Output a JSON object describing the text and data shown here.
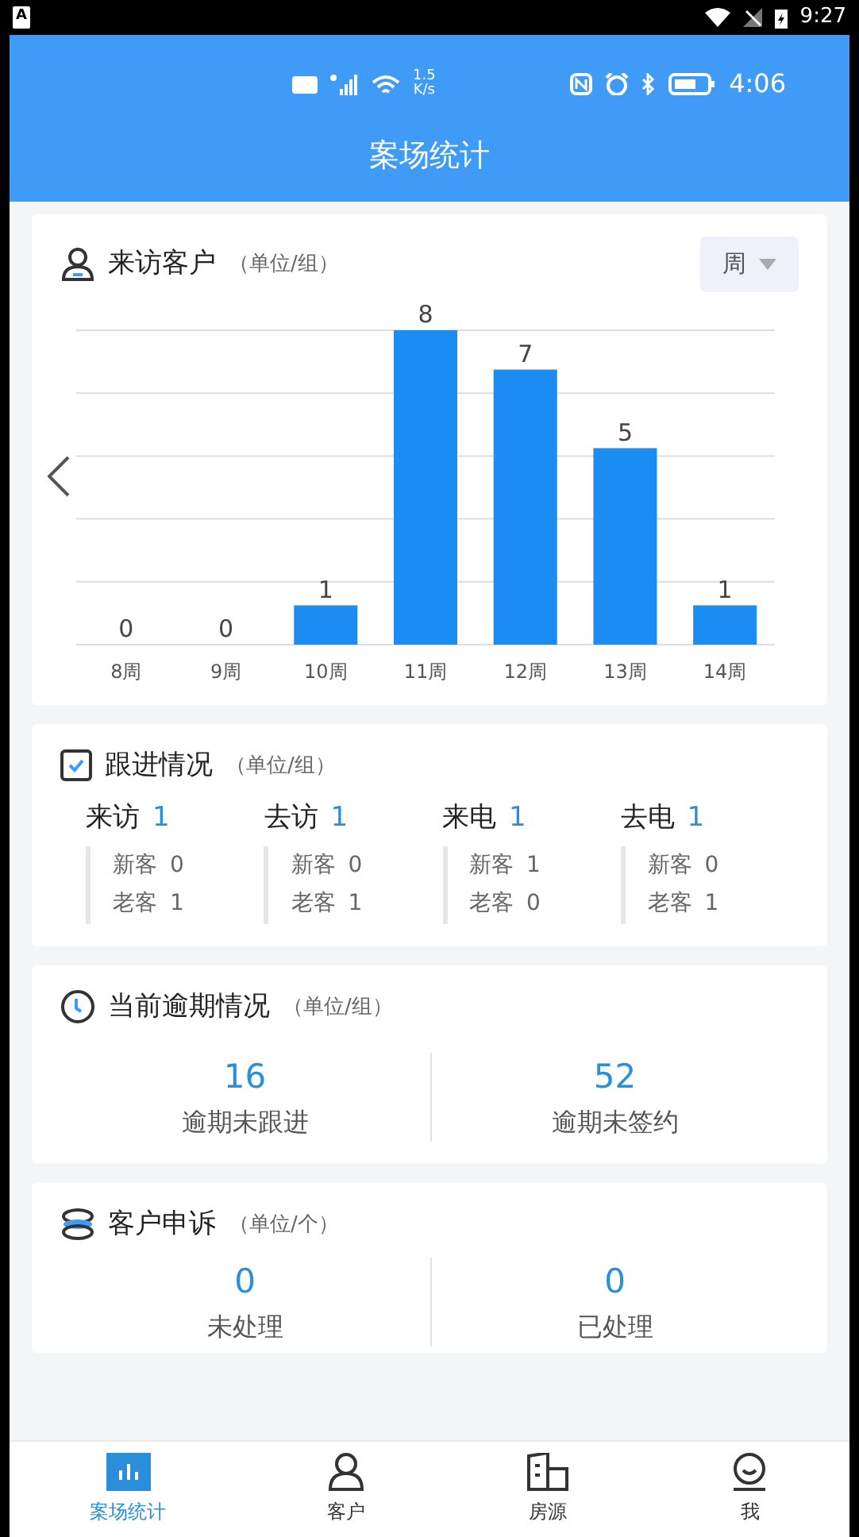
{
  "phone_status_bar": {
    "notification": "A",
    "time": "9:27"
  },
  "app_status_bar": {
    "speed": "1.5",
    "speed_unit": "K/s",
    "time": "4:06"
  },
  "header": {
    "title": "案场统计"
  },
  "visitors": {
    "title": "来访客户",
    "unit": "（单位/组）",
    "period": "周",
    "chart_data": {
      "type": "bar",
      "categories": [
        "8周",
        "9周",
        "10周",
        "11周",
        "12周",
        "13周",
        "14周"
      ],
      "values": [
        0,
        0,
        1,
        8,
        7,
        5,
        1
      ],
      "ylim": [
        0,
        8
      ],
      "data_labels": true
    }
  },
  "follow_up": {
    "title": "跟进情况",
    "unit": "（单位/组）",
    "groups": [
      {
        "label": "来访",
        "total": "1",
        "new_label": "新客",
        "new": "0",
        "old_label": "老客",
        "old": "1"
      },
      {
        "label": "去访",
        "total": "1",
        "new_label": "新客",
        "new": "0",
        "old_label": "老客",
        "old": "1"
      },
      {
        "label": "来电",
        "total": "1",
        "new_label": "新客",
        "new": "1",
        "old_label": "老客",
        "old": "0"
      },
      {
        "label": "去电",
        "total": "1",
        "new_label": "新客",
        "new": "0",
        "old_label": "老客",
        "old": "1"
      }
    ]
  },
  "overdue": {
    "title": "当前逾期情况",
    "unit": "（单位/组）",
    "stats": [
      {
        "value": "16",
        "label": "逾期未跟进"
      },
      {
        "value": "52",
        "label": "逾期未签约"
      }
    ]
  },
  "complaints": {
    "title": "客户申诉",
    "unit": "（单位/个）",
    "stats": [
      {
        "value": "0",
        "label": "未处理"
      },
      {
        "value": "0",
        "label": "已处理"
      }
    ]
  },
  "tab_bar": [
    {
      "kind": "chart",
      "label": "案场统计",
      "selected": true
    },
    {
      "kind": "person",
      "label": "客户",
      "selected": false
    },
    {
      "kind": "building",
      "label": "房源",
      "selected": false
    },
    {
      "kind": "face",
      "label": "我",
      "selected": false
    }
  ]
}
